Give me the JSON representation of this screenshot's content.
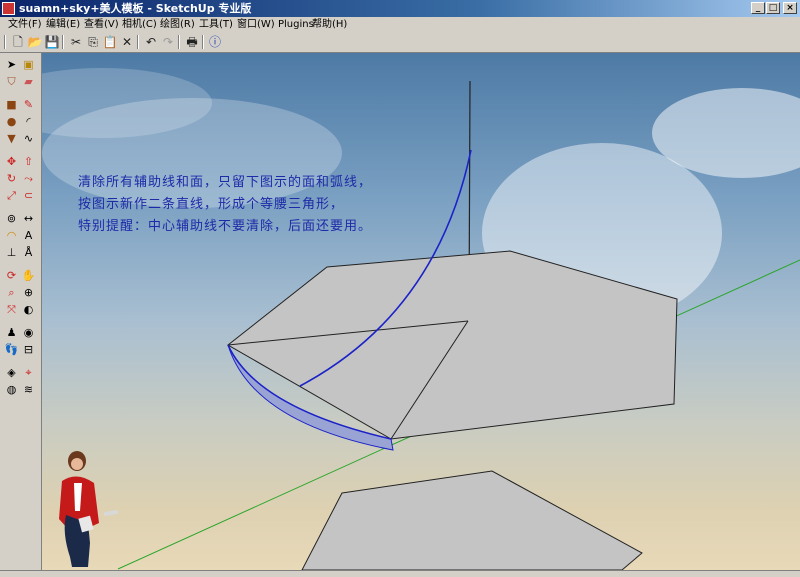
{
  "window": {
    "title": "suamn+sky+美人模板 - SketchUp 专业版"
  },
  "menu": [
    "文件(F)",
    "编辑(E)",
    "查看(V)",
    "相机(C)",
    "绘图(R)",
    "工具(T)",
    "窗口(W)",
    "Plugins",
    "帮助(H)"
  ],
  "instructions": [
    "清除所有辅助线和面，只留下图示的面和弧线，",
    "按图示新作二条直线，形成个等腰三角形，",
    "特别提醒：中心辅助线不要清除，后面还要用。"
  ],
  "colors": {
    "instruction_text": "#1e2aa8",
    "arc": "#1b22c8",
    "face": "#c4c4c4",
    "green_axis": "#2aa52a"
  }
}
